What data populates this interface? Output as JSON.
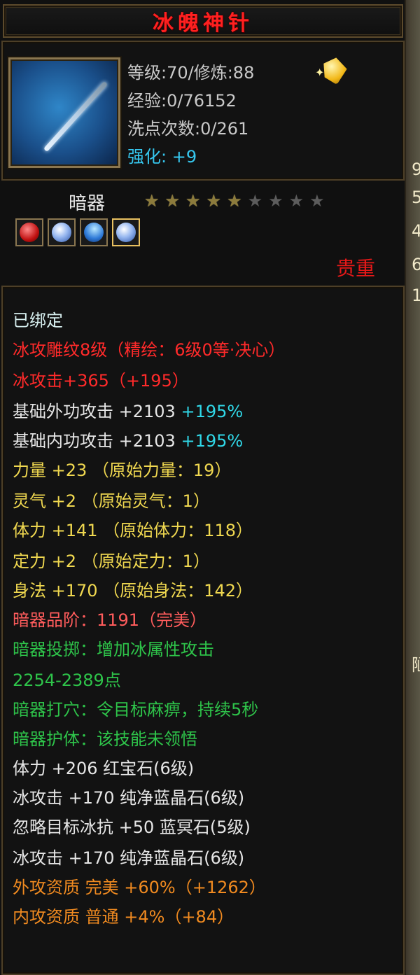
{
  "item": {
    "name": "冰魄神针",
    "level_line": "等级:70/修炼:88",
    "exp_line": "经验:0/76152",
    "reset_line": "洗点次数:0/261",
    "enhance_label": "强化:",
    "enhance_value": " +9",
    "type": "暗器",
    "stars_total": 10,
    "stars_lit": 5,
    "rarity": "贵重",
    "icon": "needle-weapon-icon",
    "sockets": [
      "red-gem-icon",
      "blue-gem-icon",
      "blue-crystal-icon",
      "white-gem-icon"
    ]
  },
  "attributes": {
    "bound": "已绑定",
    "engrave": "冰攻雕纹8级（精绘：6级0等·决心）",
    "ice_atk": "冰攻击+365（+195）",
    "ext_atk": "基础外功攻击 +2103",
    "ext_atk_pct": " +195%",
    "int_atk": "基础内功攻击 +2103",
    "int_atk_pct": " +195%",
    "str": "力量 +23 （原始力量：19）",
    "spirit": "灵气 +2 （原始灵气：1）",
    "con": "体力 +141 （原始体力：118）",
    "focus": "定力 +2 （原始定力：1）",
    "agi": "身法 +170 （原始身法：142）",
    "grade": "暗器品阶：1191（完美）",
    "throw": "暗器投掷：增加冰属性攻击",
    "throw_range": "2254-2389点",
    "acupoint": "暗器打穴：令目标麻痹，持续5秒",
    "guard": "暗器护体：该技能未领悟",
    "gem1": "体力 +206 红宝石(6级)",
    "gem2": "冰攻击 +170 纯净蓝晶石(6级)",
    "gem3": "忽略目标冰抗 +50 蓝冥石(5级)",
    "gem4": "冰攻击 +170 纯净蓝晶石(6级)",
    "ext_quality": "外攻资质  完美 +60%（+1262）",
    "int_quality": "内攻资质  普通 +4%（+84）"
  },
  "side_fragments": [
    "9",
    "5",
    "4",
    "6",
    "1",
    "陋"
  ]
}
